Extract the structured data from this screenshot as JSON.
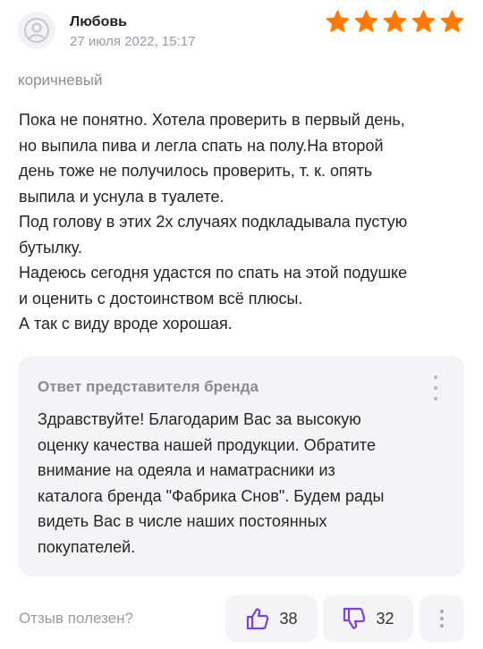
{
  "review": {
    "author": "Любовь",
    "date": "27 июля 2022, 15:17",
    "rating": 5,
    "variant": "коричневый",
    "text_lines": [
      "Пока не понятно. Хотела проверить в первый день,",
      "но выпила пива и легла спать на полу.На второй",
      "день тоже не получилось проверить, т. к. опять",
      "выпила и уснула в туалете.",
      "Под голову в этих 2х случаях подкладывала пустую",
      "бутылку.",
      "Надеюсь сегодня удастся по спать на этой подушке",
      "и оценить с достоинством всё плюсы.",
      "А так с виду вроде хорошая."
    ]
  },
  "reply": {
    "title": "Ответ представителя бренда",
    "text_lines": [
      "Здравствуйте! Благодарим Вас за высокую",
      "оценку качества нашей продукции. Обратите",
      "внимание на одеяла и наматрасники из",
      "каталога бренда \"Фабрика Снов\". Будем рады",
      "видеть Вас в числе наших постоянных",
      "покупателей."
    ]
  },
  "footer": {
    "useful_label": "Отзыв полезен?",
    "likes": "38",
    "dislikes": "32"
  },
  "colors": {
    "star": "#ff7a00",
    "thumb": "#7b3fe4",
    "reply_bg": "#f4f4f6"
  },
  "icons": {
    "avatar": "user-avatar-icon",
    "star": "star-icon",
    "like": "thumbs-up-icon",
    "dislike": "thumbs-down-icon",
    "more": "more-vertical-icon"
  }
}
